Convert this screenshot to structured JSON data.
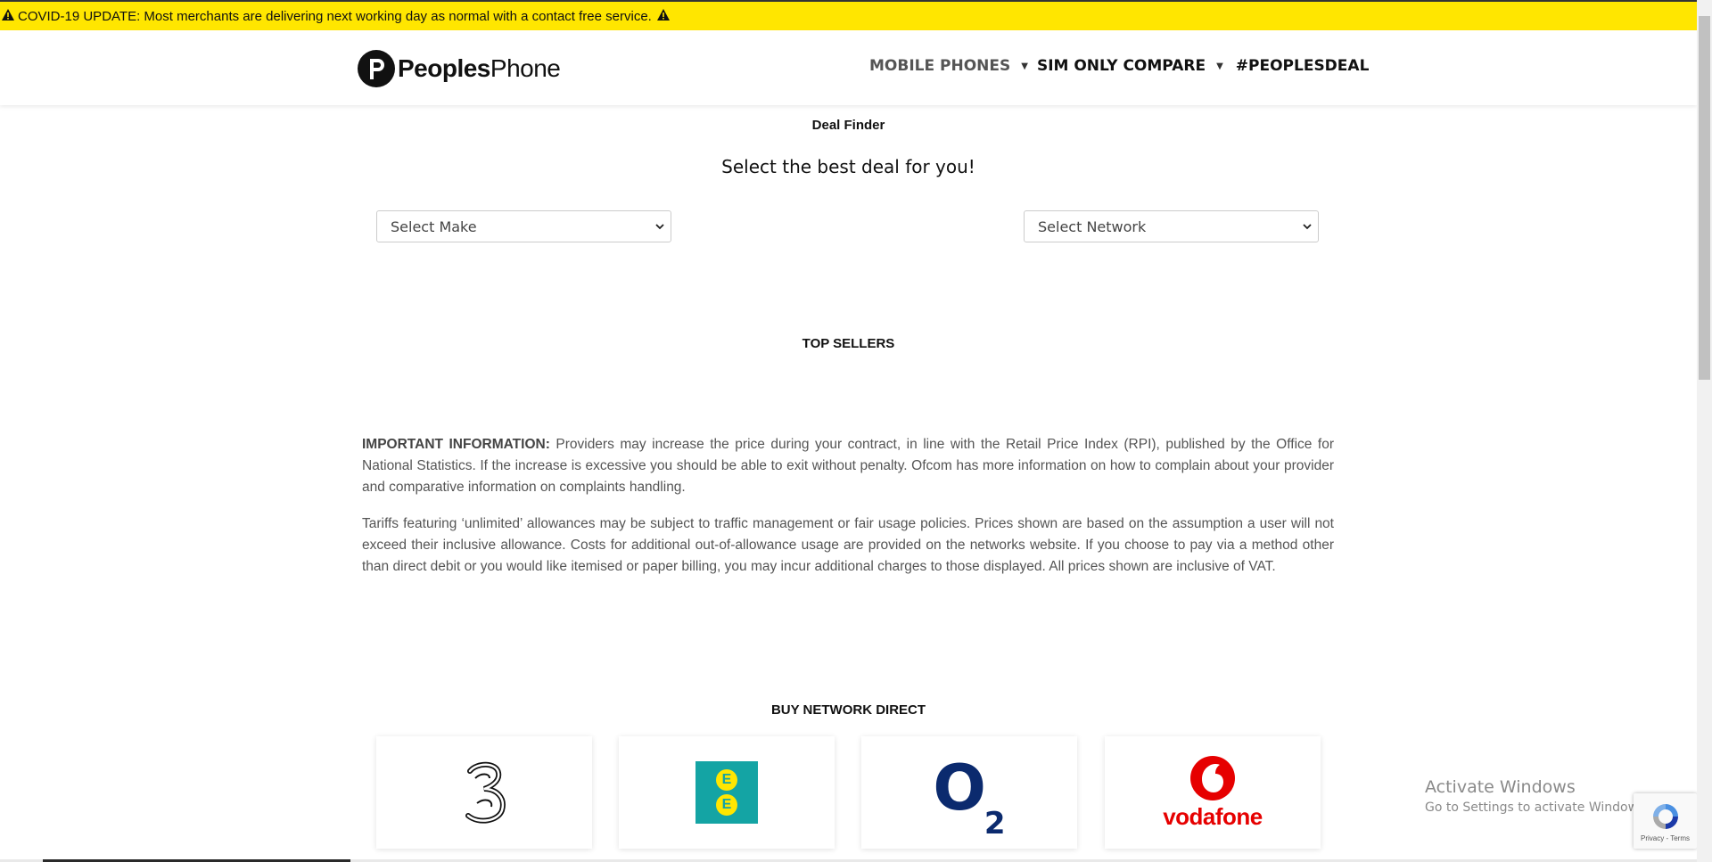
{
  "banner": {
    "text": "COVID-19 UPDATE: Most merchants are delivering next working day as normal with a contact free service."
  },
  "header": {
    "logo_bold": "Peoples",
    "logo_thin": "Phone",
    "nav": {
      "mobile_phones": "MOBILE PHONES",
      "sim_only": "SIM ONLY COMPARE",
      "peoplesdeal": "#PEOPLESDEAL"
    }
  },
  "deal_finder": {
    "title": "Deal Finder",
    "subtitle": "Select the best deal for you!",
    "make_select": "Select Make",
    "network_select": "Select Network"
  },
  "top_sellers": {
    "title": "TOP SELLERS"
  },
  "info": {
    "label": "IMPORTANT INFORMATION:",
    "p1": "Providers may increase the price during your contract, in line with the Retail Price Index (RPI), published by the Office for National Statistics. If the increase is excessive you should be able to exit without penalty. Ofcom has more information on how to complain about your provider and comparative information on complaints handling.",
    "p2": "Tariffs featuring ‘unlimited’ allowances may be subject to traffic management or fair usage policies. Prices shown are based on the assumption a user will not exceed their inclusive allowance. Costs for additional out-of-allowance usage are provided on the networks website.  If you choose to pay via a method other than direct debit or you would like itemised or paper billing, you may incur additional charges to those displayed. All prices shown are inclusive of VAT."
  },
  "network_direct": {
    "title": "BUY NETWORK DIRECT",
    "ee_letters": [
      "E",
      "E"
    ],
    "o2_main": "O",
    "o2_sub": "2",
    "vodafone": "vodafone"
  },
  "windows": {
    "line1": "Activate Windows",
    "line2": "Go to Settings to activate Windows."
  },
  "recaptcha": {
    "links": "Privacy - Terms"
  },
  "colors": {
    "banner": "#ffe600",
    "ee_teal": "#14a4a4",
    "o2_blue": "#0b2a6e",
    "vodafone_red": "#e60000"
  }
}
